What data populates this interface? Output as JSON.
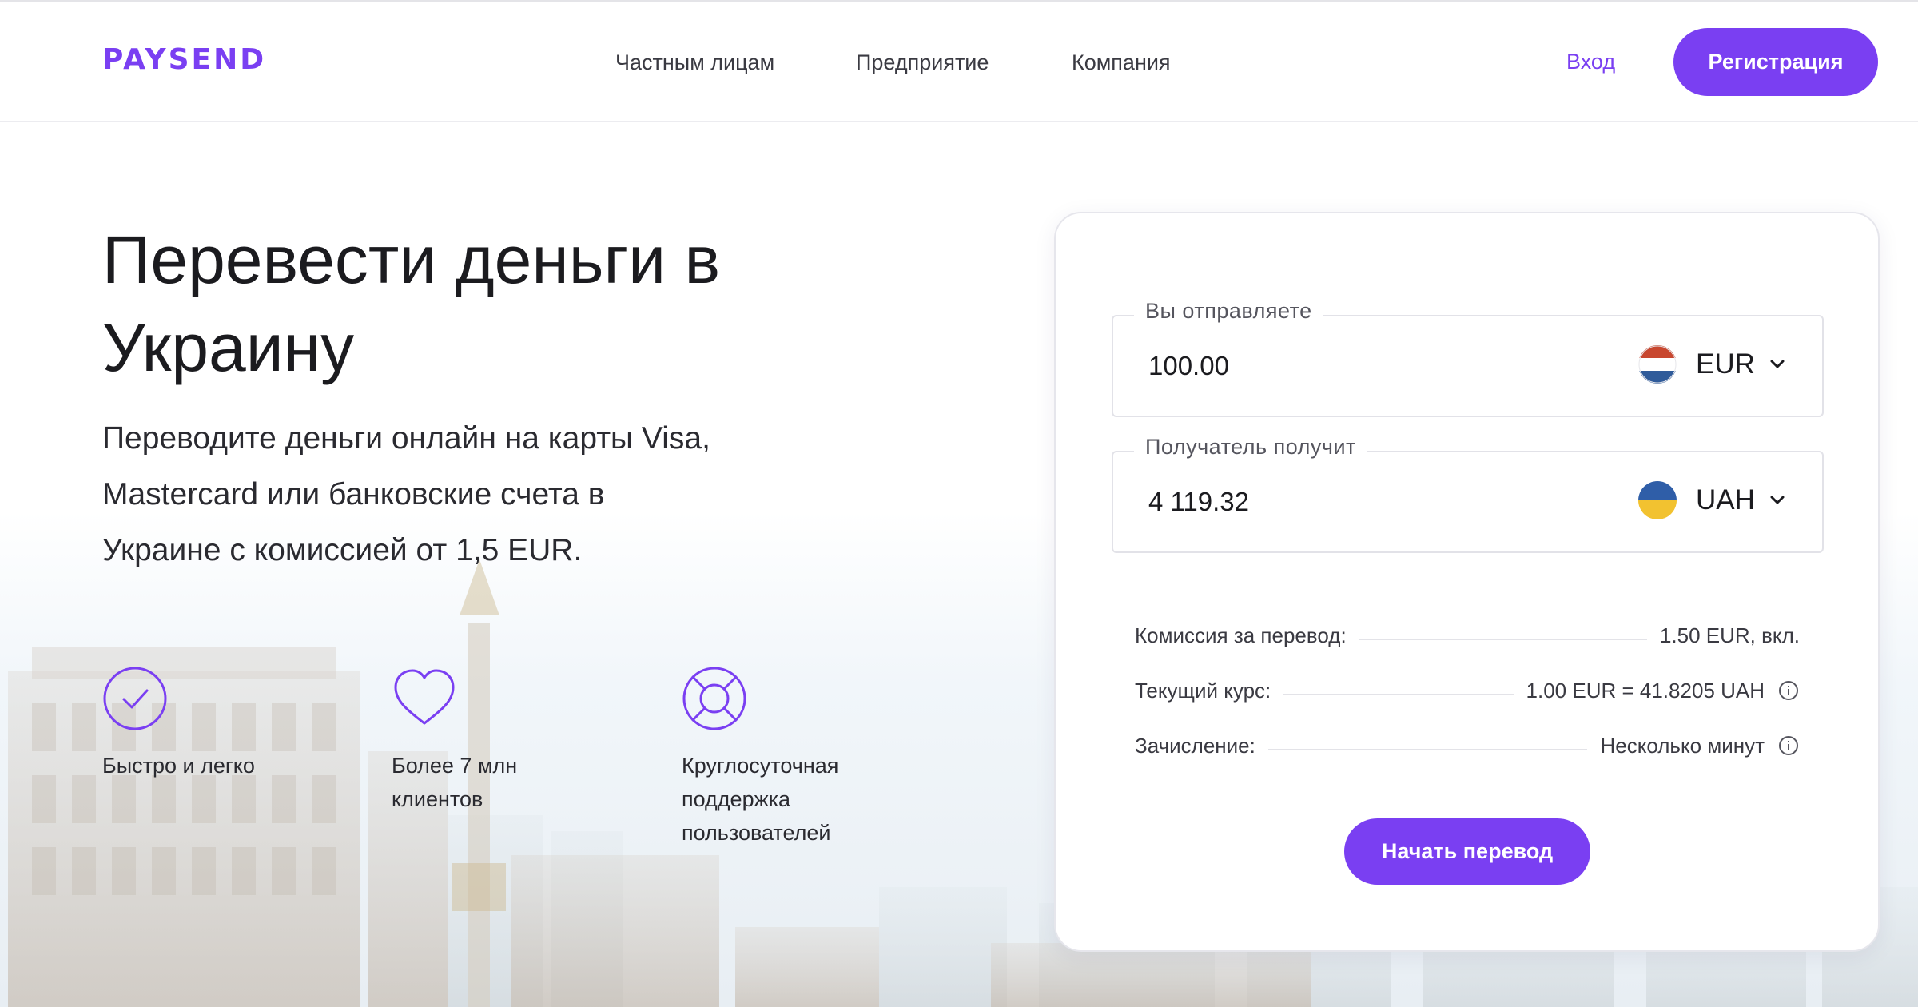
{
  "brand": {
    "logo_text": "PAYSEND",
    "accent_color": "#7a3ff2"
  },
  "nav": {
    "items": [
      {
        "label": "Частным лицам"
      },
      {
        "label": "Предприятие"
      },
      {
        "label": "Компания"
      }
    ],
    "login_label": "Вход",
    "register_label": "Регистрация"
  },
  "hero": {
    "title_line1": "Перевести деньги в",
    "title_line2": "Украину",
    "subtitle_line1": "Переводите деньги онлайн на карты Visa,",
    "subtitle_line2": "Mastercard или банковские счета в",
    "subtitle_line3": "Украине с комиссией от 1,5 EUR."
  },
  "features": [
    {
      "icon": "checkmark-circle-icon",
      "label": "Быстро и легко"
    },
    {
      "icon": "heart-icon",
      "label": "Более 7 млн клиентов"
    },
    {
      "icon": "lifebuoy-icon",
      "label_line1": "Круглосуточная",
      "label_line2": "поддержка",
      "label_line3": "пользователей"
    }
  ],
  "calculator": {
    "send": {
      "legend": "Вы отправляете",
      "amount": "100.00",
      "currency": "EUR",
      "flag": "netherlands-flag-icon"
    },
    "receive": {
      "legend": "Получатель получит",
      "amount": "4 119.32",
      "currency": "UAH",
      "flag": "ukraine-flag-icon"
    },
    "fee": {
      "label": "Комиссия за перевод:",
      "value": "1.50 EUR, вкл."
    },
    "rate": {
      "label": "Текущий курс:",
      "value": "1.00 EUR = 41.8205 UAH"
    },
    "delivery": {
      "label": "Зачисление:",
      "value": "Несколько минут"
    },
    "start_label": "Начать перевод"
  }
}
